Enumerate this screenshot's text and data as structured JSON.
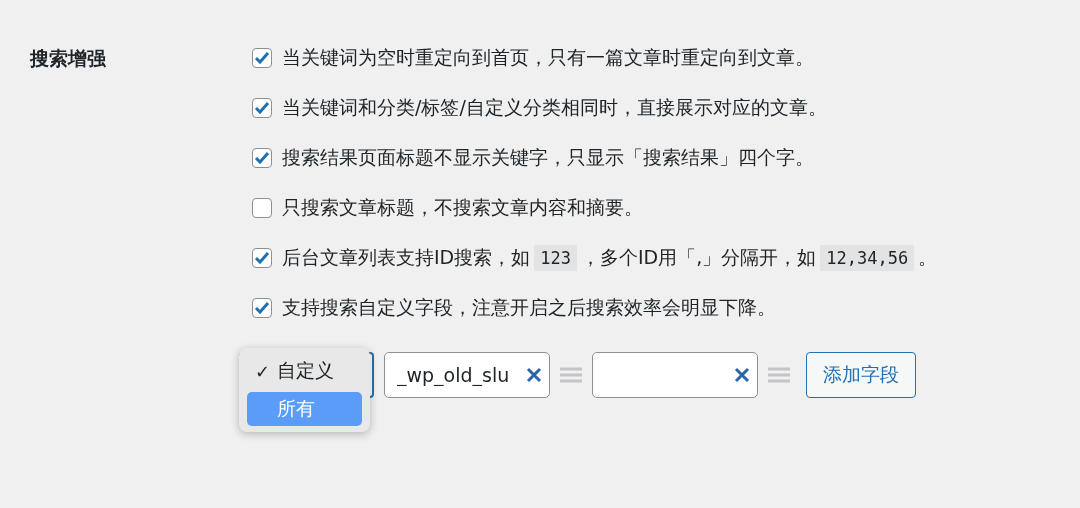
{
  "section": {
    "label": "搜索增强"
  },
  "options": [
    {
      "checked": true,
      "parts": [
        {
          "kind": "text",
          "text": "当关键词为空时重定向到首页，只有一篇文章时重定向到文章。"
        }
      ]
    },
    {
      "checked": true,
      "parts": [
        {
          "kind": "text",
          "text": "当关键词和分类/标签/自定义分类相同时，直接展示对应的文章。"
        }
      ]
    },
    {
      "checked": true,
      "parts": [
        {
          "kind": "text",
          "text": "搜索结果页面标题不显示关键字，只显示「搜索结果」四个字。"
        }
      ]
    },
    {
      "checked": false,
      "parts": [
        {
          "kind": "text",
          "text": "只搜索文章标题，不搜索文章内容和摘要。"
        }
      ]
    },
    {
      "checked": true,
      "parts": [
        {
          "kind": "text",
          "text": "后台文章列表支持ID搜索，如"
        },
        {
          "kind": "code",
          "text": "123"
        },
        {
          "kind": "text",
          "text": "，多个ID用「,」分隔开，如"
        },
        {
          "kind": "code",
          "text": "12,34,56"
        },
        {
          "kind": "text",
          "text": "。"
        }
      ]
    },
    {
      "checked": true,
      "parts": [
        {
          "kind": "text",
          "text": "支持搜索自定义字段，注意开启之后搜索效率会明显下降。"
        }
      ]
    }
  ],
  "fields_row": {
    "dropdown": {
      "expanded": true,
      "options": [
        {
          "label": "自定义",
          "checked": true,
          "highlighted": false
        },
        {
          "label": "所有",
          "checked": false,
          "highlighted": true
        }
      ]
    },
    "fields": [
      {
        "value": "_wp_old_slu",
        "clear_button": true
      },
      {
        "clear_button": true
      }
    ],
    "check_mark": "✓",
    "button": "添加字段"
  }
}
